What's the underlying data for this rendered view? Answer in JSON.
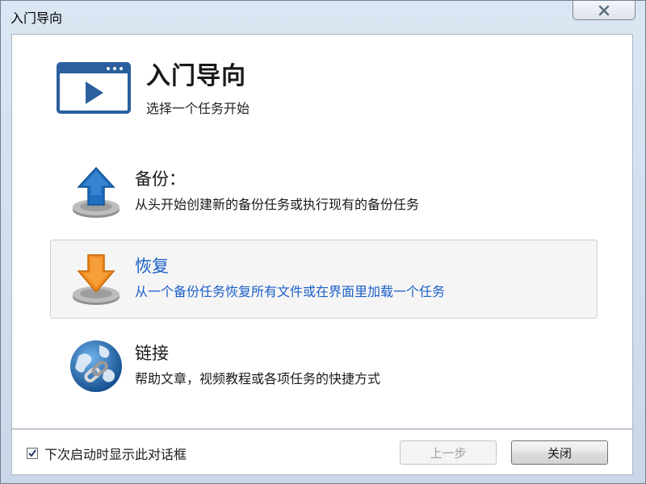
{
  "window": {
    "title": "入门导向"
  },
  "header": {
    "title": "入门导向",
    "subtitle": "选择一个任务开始"
  },
  "tasks": [
    {
      "title": "备份：",
      "description": "从头开始创建新的备份任务或执行现有的备份任务",
      "icon": "backup-upload-icon"
    },
    {
      "title": "恢复",
      "description": "从一个备份任务恢复所有文件或在界面里加载一个任务",
      "icon": "restore-download-icon"
    },
    {
      "title": "链接",
      "description": "帮助文章，视频教程或各项任务的快捷方式",
      "icon": "globe-link-icon"
    }
  ],
  "footer": {
    "checkbox_label": "下次启动时显示此对话框",
    "checkbox_checked": true,
    "back_button": "上一步",
    "close_button": "关闭"
  },
  "colors": {
    "accent_blue": "#1a5fc8",
    "upload_arrow": "#1e6fc2",
    "download_arrow": "#f08a1c",
    "window_border": "#6e7f93"
  }
}
